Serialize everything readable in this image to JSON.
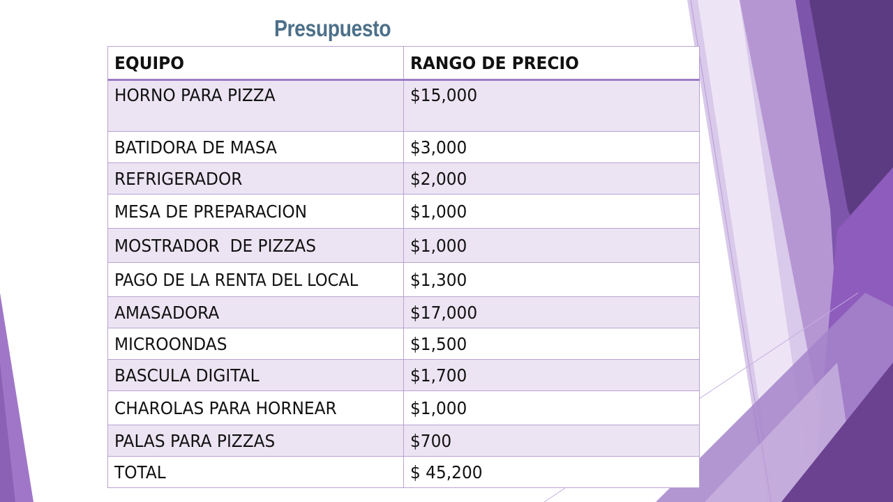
{
  "slide": {
    "title": "Presupuesto",
    "colors": {
      "title": "#4d7089",
      "table_border": "#b8a2d2",
      "header_rule": "#9b7cc4",
      "row_band": "#ece4f3",
      "accent_purple": "#7b4fa6",
      "accent_dark": "#5e3a80"
    }
  },
  "table": {
    "headers": [
      "EQUIPO",
      "RANGO DE PRECIO"
    ],
    "rows": [
      {
        "item": "HORNO PARA PIZZA",
        "price": "$15,000"
      },
      {
        "item": "BATIDORA DE MASA",
        "price": "$3,000"
      },
      {
        "item": "REFRIGERADOR",
        "price": "$2,000"
      },
      {
        "item": "MESA DE PREPARACION",
        "price": "$1,000"
      },
      {
        "item": "MOSTRADOR  DE PIZZAS",
        "price": "$1,000"
      },
      {
        "item": "PAGO DE LA RENTA DEL LOCAL",
        "price": "$1,300"
      },
      {
        "item": "AMASADORA",
        "price": "$17,000"
      },
      {
        "item": "MICROONDAS",
        "price": "$1,500"
      },
      {
        "item": "BASCULA DIGITAL",
        "price": "$1,700"
      },
      {
        "item": "CHAROLAS PARA HORNEAR",
        "price": "$1,000"
      },
      {
        "item": "PALAS PARA PIZZAS",
        "price": "$700"
      },
      {
        "item": "TOTAL",
        "price": "$ 45,200"
      }
    ]
  }
}
